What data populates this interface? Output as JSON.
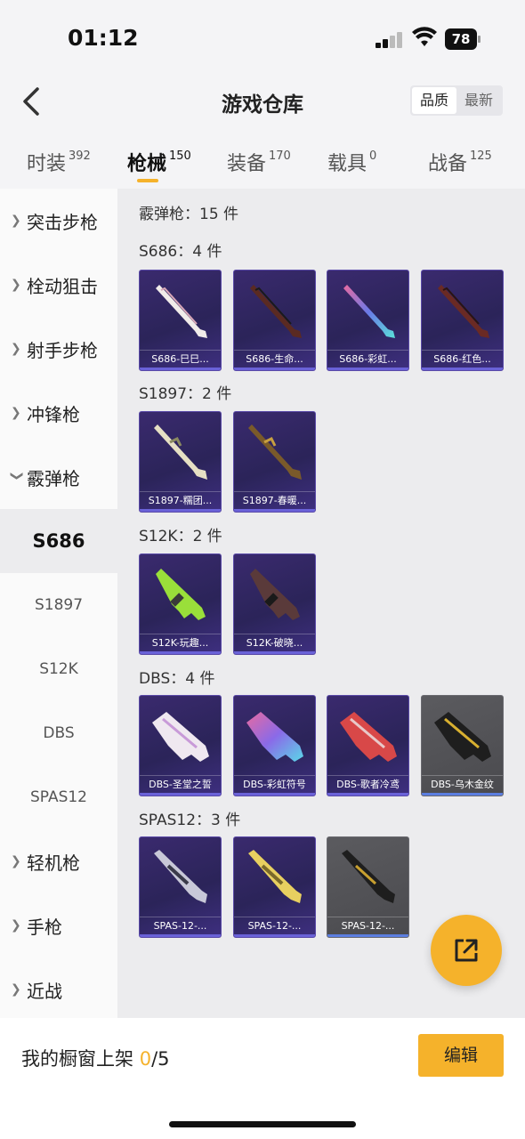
{
  "status": {
    "time": "01:12",
    "battery": "78"
  },
  "header": {
    "title": "游戏仓库",
    "sort": [
      "品质",
      "最新"
    ],
    "sort_active": 0
  },
  "tabs": [
    {
      "label": "时装",
      "count": "392"
    },
    {
      "label": "枪械",
      "count": "150"
    },
    {
      "label": "装备",
      "count": "170"
    },
    {
      "label": "载具",
      "count": "0"
    },
    {
      "label": "战备",
      "count": "125"
    }
  ],
  "sidebar": {
    "items": [
      {
        "label": "突击步枪"
      },
      {
        "label": "栓动狙击"
      },
      {
        "label": "射手步枪"
      },
      {
        "label": "冲锋枪"
      },
      {
        "label": "霰弹枪"
      },
      {
        "label": "S686"
      },
      {
        "label": "S1897"
      },
      {
        "label": "S12K"
      },
      {
        "label": "DBS"
      },
      {
        "label": "SPAS12"
      },
      {
        "label": "轻机枪"
      },
      {
        "label": "手枪"
      },
      {
        "label": "近战"
      }
    ]
  },
  "content": {
    "category_title": "霰弹枪：15 件",
    "groups": [
      {
        "title": "S686：4 件",
        "items": [
          "S686-巳巳...",
          "S686-生命...",
          "S686-彩虹...",
          "S686-红色..."
        ]
      },
      {
        "title": "S1897：2 件",
        "items": [
          "S1897-糯团...",
          "S1897-春暖..."
        ]
      },
      {
        "title": "S12K：2 件",
        "items": [
          "S12K-玩趣...",
          "S12K-破晓..."
        ]
      },
      {
        "title": "DBS：4 件",
        "items": [
          "DBS-圣堂之誓",
          "DBS-彩虹符号",
          "DBS-歌者冷鸢",
          "DBS-乌木金纹"
        ]
      },
      {
        "title": "SPAS12：3 件",
        "items": [
          "SPAS-12-...",
          "SPAS-12-...",
          "SPAS-12-..."
        ]
      }
    ]
  },
  "footer": {
    "shelf_label": "我的橱窗上架 ",
    "shelf_count": "0",
    "shelf_total": "/5",
    "edit_label": "编辑"
  },
  "colors": {
    "accent": "#f5b22b",
    "card_purple": "#2b2459",
    "card_gray": "#4a4a4e"
  }
}
